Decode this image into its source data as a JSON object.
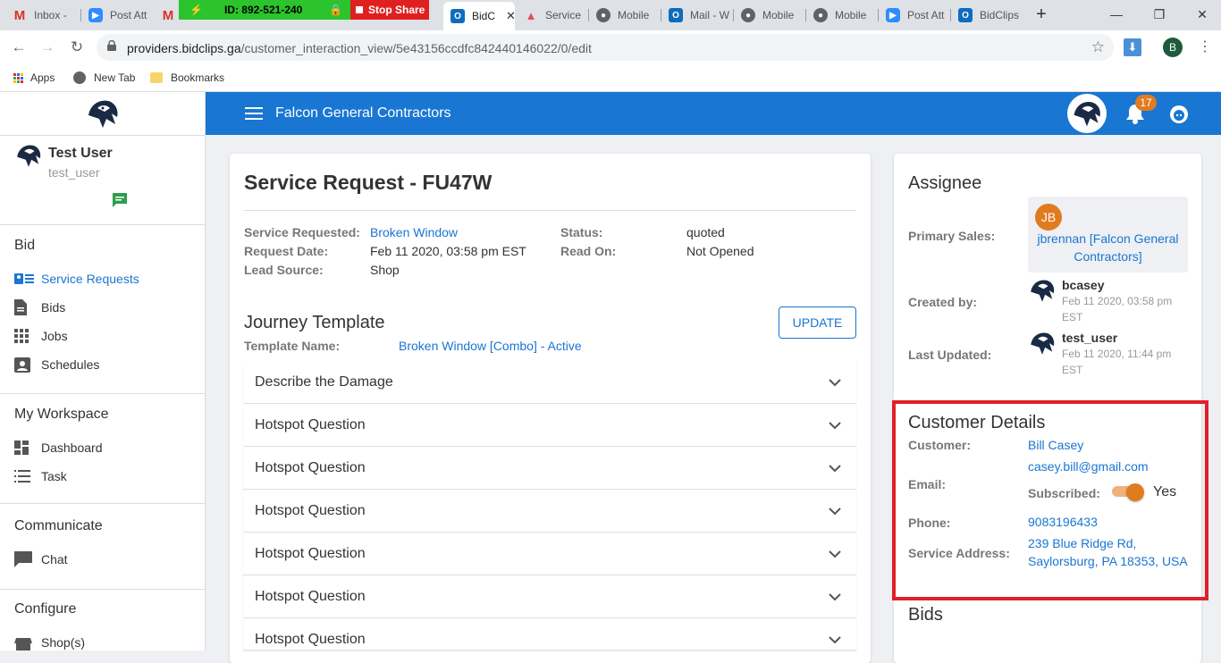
{
  "browser": {
    "tabs": [
      {
        "label": "Inbox -",
        "icon": "gmail-icon",
        "color": "#d93025"
      },
      {
        "label": "Post Att",
        "icon": "zoom-icon",
        "color": "#2d8cff"
      },
      {
        "label": "",
        "icon": "gmail-icon",
        "color": "#d93025"
      },
      {
        "label": "BidC",
        "icon": "outlook-icon",
        "color": "#0f6cbd"
      },
      {
        "label": "Service",
        "icon": "servicetitan-icon",
        "color": "#e84a5f"
      },
      {
        "label": "Mobile",
        "icon": "globe-icon",
        "color": "#5f6368"
      },
      {
        "label": "Mail - W",
        "icon": "outlook-icon",
        "color": "#0f6cbd"
      },
      {
        "label": "Mobile",
        "icon": "globe-icon",
        "color": "#5f6368"
      },
      {
        "label": "Mobile",
        "icon": "globe-icon",
        "color": "#5f6368"
      },
      {
        "label": "Post Att",
        "icon": "zoom-icon",
        "color": "#2d8cff"
      },
      {
        "label": "BidClips",
        "icon": "outlook-icon",
        "color": "#0f6cbd"
      }
    ],
    "share_id": "ID: 892-521-240",
    "stop_share": "Stop Share",
    "url_host": "providers.bidclips.ga",
    "url_path": "/customer_interaction_view/5e43156ccdfc842440146022/0/edit",
    "profile_initial": "B",
    "bookmarks": [
      "Apps",
      "New Tab",
      "Bookmarks"
    ]
  },
  "app": {
    "company": "Falcon General Contractors",
    "notification_count": "17",
    "user_name": "Test User",
    "user_handle": "test_user",
    "sidebar": {
      "bid_section": "Bid",
      "bid_items": [
        "Service Requests",
        "Bids",
        "Jobs",
        "Schedules"
      ],
      "workspace_section": "My Workspace",
      "workspace_items": [
        "Dashboard",
        "Task"
      ],
      "communicate_section": "Communicate",
      "communicate_items": [
        "Chat"
      ],
      "configure_section": "Configure",
      "configure_items": [
        "Shop(s)"
      ]
    }
  },
  "request": {
    "title": "Service Request - FU47W",
    "service_requested_label": "Service Requested:",
    "service_requested": "Broken Window",
    "request_date_label": "Request Date:",
    "request_date": "Feb 11 2020, 03:58 pm EST",
    "lead_source_label": "Lead Source:",
    "lead_source": "Shop",
    "status_label": "Status:",
    "status": "quoted",
    "read_on_label": "Read On:",
    "read_on": "Not Opened",
    "journey_title": "Journey Template",
    "update_button": "UPDATE",
    "template_name_label": "Template Name:",
    "template_name": "Broken Window [Combo] - Active",
    "questions": [
      "Describe the Damage",
      "Hotspot Question",
      "Hotspot Question",
      "Hotspot Question",
      "Hotspot Question",
      "Hotspot Question",
      "Hotspot Question"
    ]
  },
  "assignee": {
    "title": "Assignee",
    "primary_sales_label": "Primary Sales:",
    "primary_initials": "JB",
    "primary_name_line1": "jbrennan [Falcon General",
    "primary_name_line2": "Contractors]",
    "created_by_label": "Created by:",
    "created_by": "bcasey",
    "created_date_line1": "Feb 11 2020, 03:58 pm",
    "created_date_line2": "EST",
    "last_updated_label": "Last Updated:",
    "updated_by": "test_user",
    "updated_date_line1": "Feb 11 2020, 11:44 pm",
    "updated_date_line2": "EST"
  },
  "customer": {
    "title": "Customer Details",
    "customer_label": "Customer:",
    "customer_name": "Bill Casey",
    "email": "casey.bill@gmail.com",
    "email_label": "Email:",
    "subscribed_label": "Subscribed:",
    "subscribed_value": "Yes",
    "phone_label": "Phone:",
    "phone": "9083196433",
    "address_label": "Service Address:",
    "address_line1": "239 Blue Ridge Rd,",
    "address_line2": "Saylorsburg, PA 18353, USA"
  },
  "bids": {
    "title": "Bids"
  },
  "colors": {
    "primary": "#1976d2",
    "toggle": "#e07b1e",
    "highlight": "#e0202a",
    "avatar": "#e07b1e",
    "chat_icon": "#2e9d4c"
  }
}
